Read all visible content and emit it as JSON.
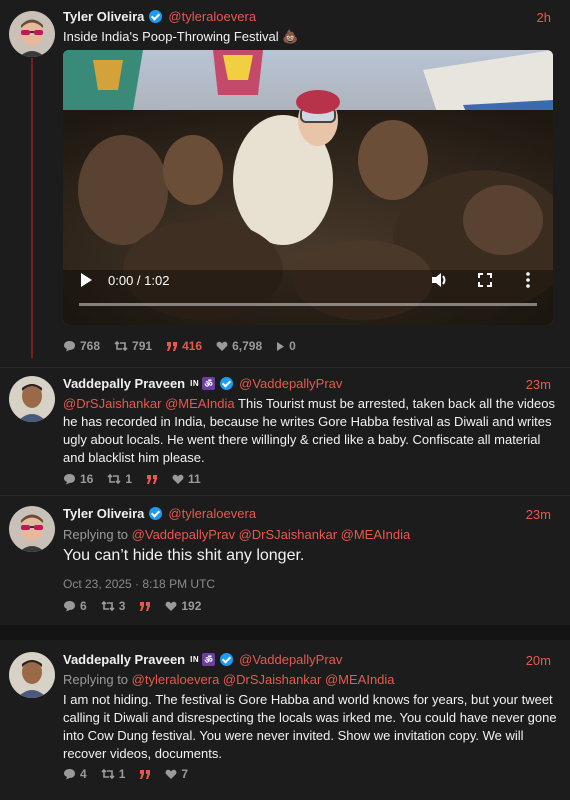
{
  "tweet1": {
    "name": "Tyler Oliveira",
    "handle": "@tyleraloevera",
    "time": "2h",
    "text": "Inside India's Poop-Throwing Festival 💩",
    "video": {
      "time_display": "0:00 / 1:02",
      "progress": 0
    },
    "stats": {
      "replies": "768",
      "retweets": "791",
      "quotes": "416",
      "likes": "6,798",
      "views": "0"
    }
  },
  "tweet2": {
    "name": "Vaddepally Praveen",
    "badges": {
      "in": "IN",
      "om": "ॐ"
    },
    "handle": "@VaddepallyPrav",
    "time": "23m",
    "mention1": "@DrSJaishankar",
    "mention2": "@MEAIndia",
    "text": "This Tourist must be arrested, taken back all the videos he has recorded in India, because he writes Gore Habba festival as Diwali and writes ugly about locals. He went there willingly & cried like a baby. Confiscate all material and blacklist him please.",
    "stats": {
      "replies": "16",
      "retweets": "1",
      "likes": "11"
    }
  },
  "tweet3": {
    "name": "Tyler Oliveira",
    "handle": "@tyleraloevera",
    "time": "23m",
    "replying_prefix": "Replying to",
    "replying_to": "@VaddepallyPrav @DrSJaishankar @MEAIndia",
    "text": "You can’t hide this shit any longer.",
    "timestamp": "Oct 23, 2025 · 8:18 PM UTC",
    "stats": {
      "replies": "6",
      "retweets": "3",
      "likes": "192"
    }
  },
  "tweet4": {
    "name": "Vaddepally Praveen",
    "badges": {
      "in": "IN",
      "om": "ॐ"
    },
    "handle": "@VaddepallyPrav",
    "time": "20m",
    "replying_prefix": "Replying to",
    "replying_to": "@tyleraloevera @DrSJaishankar @MEAIndia",
    "text": "I am not hiding. The festival is Gore Habba and world knows for years, but your tweet calling it Diwali and disrespecting the locals was irked me. You could have never gone into Cow Dung festival. You were never invited. Show we invitation copy. We will recover videos, documents.",
    "stats": {
      "replies": "4",
      "retweets": "1",
      "likes": "7"
    }
  },
  "colors": {
    "accent": "#e8584f",
    "verified": "#1d9bf0",
    "background": "#1c1c1c"
  }
}
